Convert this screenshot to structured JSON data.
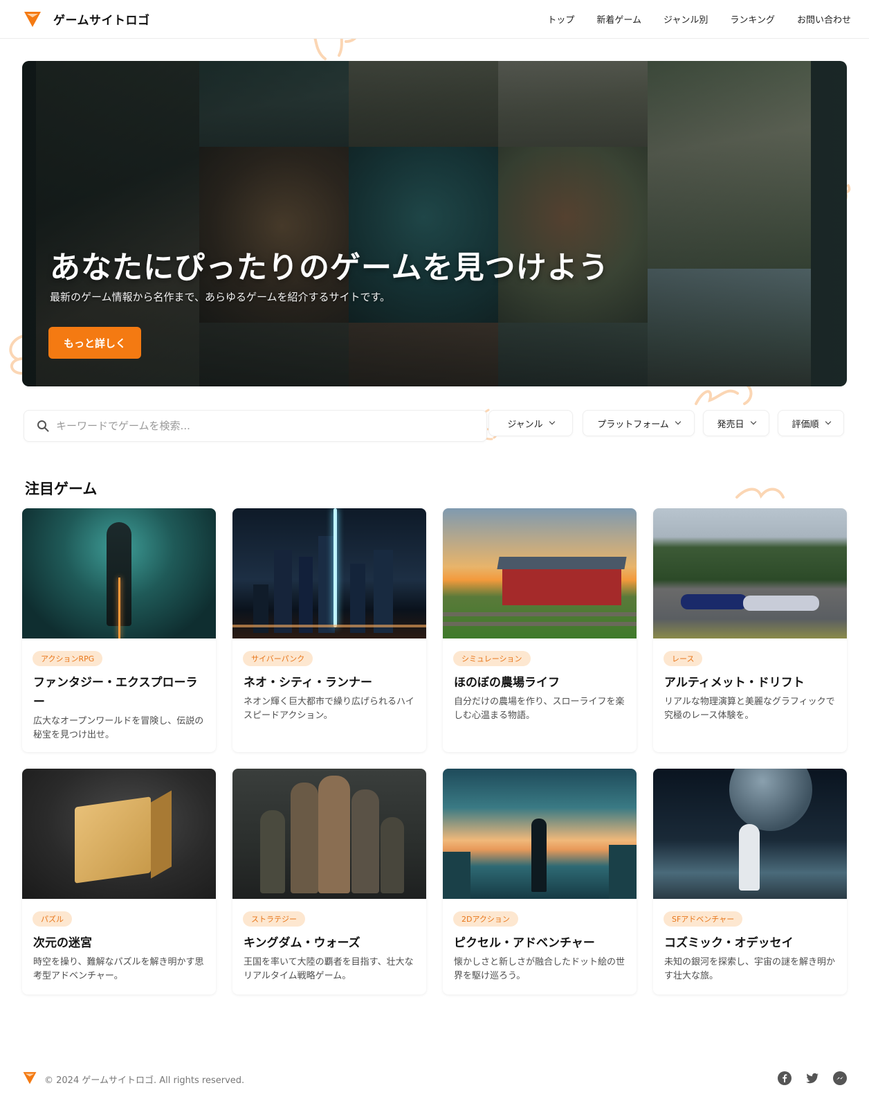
{
  "header": {
    "logo_text": "ゲームサイトロゴ",
    "nav": [
      "トップ",
      "新着ゲーム",
      "ジャンル別",
      "ランキング",
      "お問い合わせ"
    ]
  },
  "hero": {
    "title": "あなたにぴったりのゲームを見つけよう",
    "subtitle": "最新のゲーム情報から名作まで、あらゆるゲームを紹介するサイトです。",
    "button": "もっと詳しく"
  },
  "search": {
    "placeholder": "キーワードでゲームを検索...",
    "filters": [
      "ジャンル",
      "プラットフォーム",
      "発売日",
      "評価順"
    ]
  },
  "featured": {
    "title": "注目ゲーム",
    "games": [
      {
        "genre": "アクションRPG",
        "title": "ファンタジー・エクスプローラー",
        "desc": "広大なオープンワールドを冒険し、伝説の秘宝を見つけ出せ。"
      },
      {
        "genre": "サイバーパンク",
        "title": "ネオ・シティ・ランナー",
        "desc": "ネオン輝く巨大都市で繰り広げられるハイスピードアクション。"
      },
      {
        "genre": "シミュレーション",
        "title": "ほのぼの農場ライフ",
        "desc": "自分だけの農場を作り、スローライフを楽しむ心温まる物語。"
      },
      {
        "genre": "レース",
        "title": "アルティメット・ドリフト",
        "desc": "リアルな物理演算と美麗なグラフィックで究極のレース体験を。"
      },
      {
        "genre": "パズル",
        "title": "次元の迷宮",
        "desc": "時空を操り、難解なパズルを解き明かす思考型アドベンチャー。"
      },
      {
        "genre": "ストラテジー",
        "title": "キングダム・ウォーズ",
        "desc": "王国を率いて大陸の覇者を目指す、壮大なリアルタイム戦略ゲーム。"
      },
      {
        "genre": "2Dアクション",
        "title": "ピクセル・アドベンチャー",
        "desc": "懐かしさと新しさが融合したドット絵の世界を駆け巡ろう。"
      },
      {
        "genre": "SFアドベンチャー",
        "title": "コズミック・オデッセイ",
        "desc": "未知の銀河を探索し、宇宙の謎を解き明かす壮大な旅。"
      }
    ]
  },
  "footer": {
    "copyright": "© 2024 ゲームサイトロゴ. All rights reserved.",
    "social_icons": [
      "facebook-icon",
      "twitter-icon",
      "messenger-icon"
    ]
  },
  "colors": {
    "accent": "#f47a12",
    "badge_bg": "#fde7d0",
    "badge_text": "#e8761a"
  }
}
